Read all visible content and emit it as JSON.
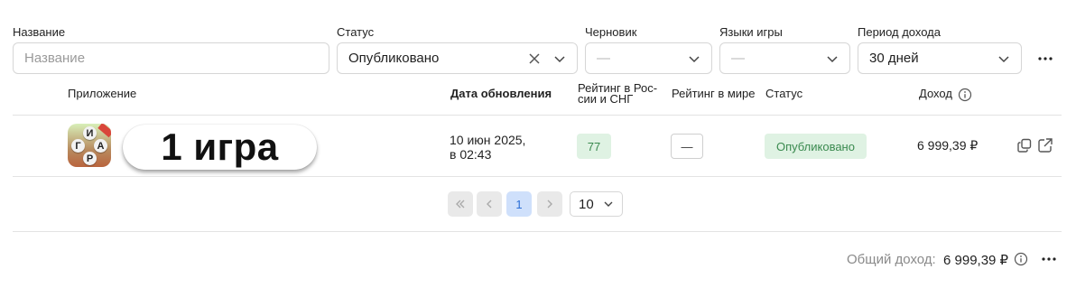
{
  "filters": {
    "name": {
      "label": "Название",
      "placeholder": "Название"
    },
    "status": {
      "label": "Статус",
      "value": "Опубликовано"
    },
    "draft": {
      "label": "Черновик",
      "value": "—"
    },
    "languages": {
      "label": "Языки игры",
      "value": "—"
    },
    "period": {
      "label": "Период дохода",
      "value": "30 дней"
    }
  },
  "table": {
    "headers": {
      "app": "Приложение",
      "updated": "Дата обновления",
      "rating_ru_1": "Рейтинг в Рос-",
      "rating_ru_2": "сии и СНГ",
      "rating_world": "Рейтинг в мире",
      "status": "Статус",
      "income": "Доход"
    },
    "rows": [
      {
        "icon_letters": [
          "И",
          "Г",
          "А",
          "Р"
        ],
        "name": "1 игра",
        "date_line1": "10 июн 2025,",
        "date_line2": "в 02:43",
        "rating_ru": "77",
        "rating_world": "—",
        "status": "Опубликовано",
        "income": "6 999,39 ₽"
      }
    ]
  },
  "pagination": {
    "current_page": "1",
    "page_size": "10"
  },
  "footer": {
    "total_label": "Общий доход:",
    "total_value": "6 999,39 ₽"
  },
  "colors": {
    "accent_green_bg": "#dff2e3",
    "accent_green_text": "#3a8a4f",
    "pagination_active_bg": "#cfe0fb",
    "pagination_active_text": "#2b6fd6"
  },
  "icons": [
    "clear-icon",
    "chevron-down-icon",
    "more-icon",
    "info-icon",
    "copy-icon",
    "external-link-icon",
    "first-page-icon",
    "prev-page-icon",
    "next-page-icon"
  ]
}
